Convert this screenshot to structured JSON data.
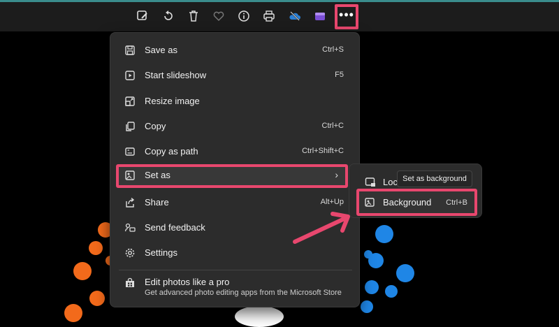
{
  "toolbar": {
    "buttons": [
      {
        "name": "edit-image-icon"
      },
      {
        "name": "rotate-icon"
      },
      {
        "name": "delete-icon"
      },
      {
        "name": "favorite-heart-icon"
      },
      {
        "name": "info-icon"
      },
      {
        "name": "print-icon"
      },
      {
        "name": "onedrive-cloud-icon"
      },
      {
        "name": "clipchamp-icon"
      }
    ],
    "more_label": "•••"
  },
  "menu": {
    "items": [
      {
        "label": "Save as",
        "shortcut": "Ctrl+S",
        "icon": "save-icon"
      },
      {
        "label": "Start slideshow",
        "shortcut": "F5",
        "icon": "slideshow-icon"
      },
      {
        "label": "Resize image",
        "shortcut": "",
        "icon": "resize-icon"
      },
      {
        "label": "Copy",
        "shortcut": "Ctrl+C",
        "icon": "copy-icon"
      },
      {
        "label": "Copy as path",
        "shortcut": "Ctrl+Shift+C",
        "icon": "copy-path-icon"
      },
      {
        "label": "Set as",
        "shortcut": "",
        "icon": "set-as-icon"
      },
      {
        "label": "Share",
        "shortcut": "Alt+Up",
        "icon": "share-icon"
      },
      {
        "label": "Send feedback",
        "shortcut": "",
        "icon": "feedback-icon"
      },
      {
        "label": "Settings",
        "shortcut": "",
        "icon": "settings-gear-icon"
      }
    ],
    "promo": {
      "title": "Edit photos like a pro",
      "subtitle": "Get advanced photo editing apps from the Microsoft Store",
      "icon": "store-icon"
    },
    "chevron": "›"
  },
  "submenu": {
    "lock_label": "Lock",
    "lock_visible": "Loc",
    "background_label": "Background",
    "background_shortcut": "Ctrl+B",
    "tooltip": "Set as background"
  },
  "colors": {
    "highlight": "#e8476e",
    "toolbar_accent": "#3a8c8c",
    "menu_bg": "#2c2c2c",
    "orange": "#f26a1b",
    "blue": "#1f86e6"
  }
}
